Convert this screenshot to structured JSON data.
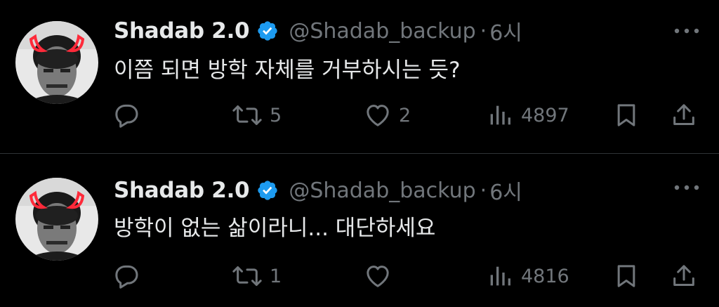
{
  "tweets": [
    {
      "display_name": "Shadab 2.0",
      "handle": "@Shadab_backup",
      "separator": "·",
      "time": "6시",
      "text": "이쯤 되면 방학 자체를 거부하시는 듯?",
      "replies": "",
      "retweets": "5",
      "likes": "2",
      "views": "4897"
    },
    {
      "display_name": "Shadab 2.0",
      "handle": "@Shadab_backup",
      "separator": "·",
      "time": "6시",
      "text": "방학이 없는 삶이라니... 대단하세요",
      "replies": "",
      "retweets": "1",
      "likes": "",
      "views": "4816"
    }
  ],
  "colors": {
    "background": "#000000",
    "text_primary": "#e7e9ea",
    "text_secondary": "#71767b",
    "verified_blue": "#1d9bf0",
    "divider": "#2f3336",
    "horns_red": "#ff2a3a"
  },
  "icons": {
    "verified": "verified-badge-icon",
    "more": "more-options-icon",
    "reply": "reply-icon",
    "retweet": "retweet-icon",
    "like": "heart-icon",
    "views": "views-chart-icon",
    "bookmark": "bookmark-icon",
    "share": "share-icon"
  }
}
